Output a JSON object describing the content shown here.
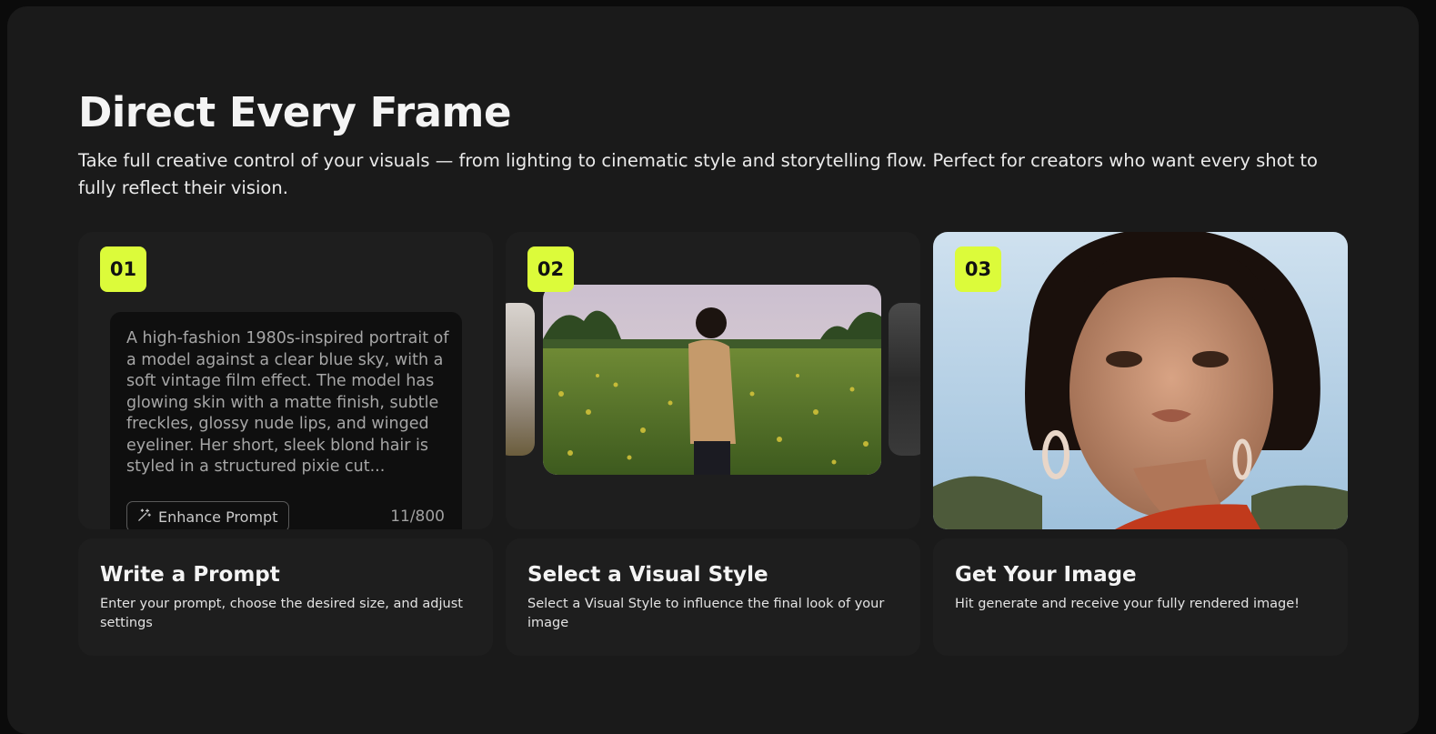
{
  "section": {
    "title": "Direct Every Frame",
    "subtitle": "Take full creative control of your visuals — from lighting to cinematic style and storytelling flow. Perfect for creators who want every shot to fully reflect their vision."
  },
  "colors": {
    "accent": "#dcfb3a",
    "background": "#1a1a1a",
    "card": "#1e1e1e"
  },
  "steps": [
    {
      "number": "01",
      "title": "Write a Prompt",
      "description": "Enter your prompt, choose the desired size, and adjust settings",
      "prompt": {
        "text": "A high-fashion 1980s-inspired portrait of a model against a clear blue sky, with a soft vintage film effect. The model has glowing skin with a matte finish, subtle freckles, glossy nude lips, and winged eyeliner. Her short, sleek blond hair is styled in a structured pixie cut...",
        "enhance_label": "Enhance Prompt",
        "enhance_icon": "magic-wand-icon",
        "counter": "11/800"
      }
    },
    {
      "number": "02",
      "title": "Select a Visual Style",
      "description": "Select a Visual Style to influence the final look of your image"
    },
    {
      "number": "03",
      "title": "Get Your Image",
      "description": "Hit generate and receive your fully rendered image!"
    }
  ]
}
